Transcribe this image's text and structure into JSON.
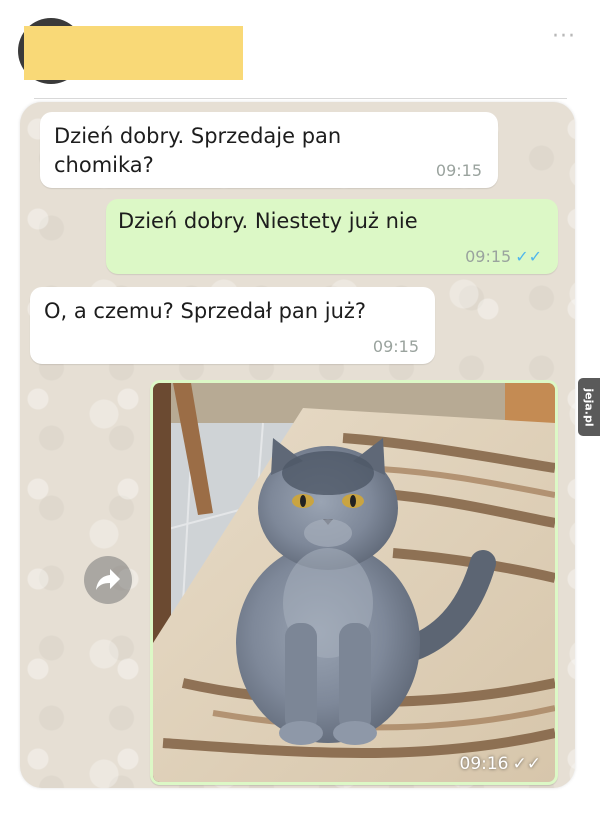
{
  "chat": {
    "messages": [
      {
        "direction": "incoming",
        "text": "Dzień dobry. Sprzedaje pan\nchomika?",
        "time": "09:15"
      },
      {
        "direction": "outgoing",
        "text": "Dzień dobry. Niestety już nie",
        "time": "09:15",
        "status": "read"
      },
      {
        "direction": "incoming",
        "text": "O, a czemu? Sprzedał pan już?",
        "time": "09:15"
      },
      {
        "direction": "outgoing",
        "type": "image",
        "image": "grey-cat-photo",
        "time": "09:16",
        "status": "delivered"
      }
    ]
  },
  "icons": {
    "more": "more-dots-icon",
    "forward": "forward-arrow-icon",
    "read_ticks": "double-check-icon"
  },
  "watermark": {
    "text": "jeja.pl"
  },
  "colors": {
    "incoming_bubble": "#ffffff",
    "outgoing_bubble": "#dcf8c6",
    "chat_background": "#e6dfd4",
    "read_tick": "#4fb6ec",
    "redaction": "#f9d977"
  }
}
